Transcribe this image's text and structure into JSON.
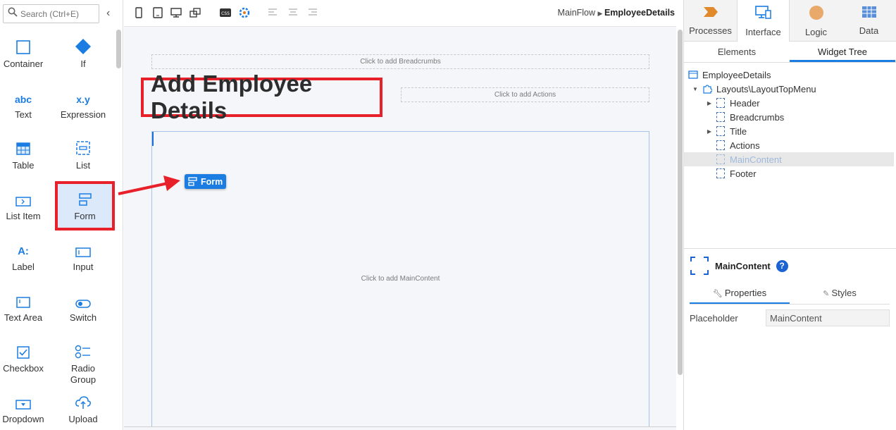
{
  "toolbox": {
    "search_placeholder": "Search (Ctrl+E)",
    "collapse_glyph": "‹",
    "tools": [
      {
        "label": "Container",
        "icon": "container-icon"
      },
      {
        "label": "If",
        "icon": "if-diamond-icon"
      },
      {
        "label": "Text",
        "icon": "text-abc-icon",
        "glyph": "abc"
      },
      {
        "label": "Expression",
        "icon": "expression-icon",
        "glyph": "x.y"
      },
      {
        "label": "Table",
        "icon": "table-icon"
      },
      {
        "label": "List",
        "icon": "list-icon"
      },
      {
        "label": "List Item",
        "icon": "list-item-icon"
      },
      {
        "label": "Form",
        "icon": "form-icon",
        "selected": true
      },
      {
        "label": "Label",
        "icon": "label-icon",
        "glyph": "A:"
      },
      {
        "label": "Input",
        "icon": "input-icon"
      },
      {
        "label": "Text Area",
        "icon": "text-area-icon"
      },
      {
        "label": "Switch",
        "icon": "switch-icon"
      },
      {
        "label": "Checkbox",
        "icon": "checkbox-icon"
      },
      {
        "label": "Radio Group",
        "icon": "radio-group-icon"
      },
      {
        "label": "Dropdown",
        "icon": "dropdown-icon"
      },
      {
        "label": "Upload",
        "icon": "upload-icon"
      }
    ]
  },
  "canvas": {
    "breadcrumb": {
      "flow": "MainFlow",
      "screen": "EmployeeDetails"
    },
    "breadcrumbs_placeholder": "Click to add Breadcrumbs",
    "title": "Add Employee Details",
    "actions_placeholder": "Click to add Actions",
    "main_placeholder": "Click to add MainContent",
    "drag_chip_label": "Form"
  },
  "right_panel": {
    "tabs": [
      {
        "label": "Processes",
        "icon": "processes-icon"
      },
      {
        "label": "Interface",
        "icon": "interface-icon",
        "active": true
      },
      {
        "label": "Logic",
        "icon": "logic-icon"
      },
      {
        "label": "Data",
        "icon": "data-icon"
      }
    ],
    "subtabs": [
      {
        "label": "Elements"
      },
      {
        "label": "Widget Tree",
        "active": true
      }
    ],
    "tree": [
      {
        "label": "EmployeeDetails",
        "icon": "screen-icon"
      },
      {
        "label": "Layouts\\LayoutTopMenu",
        "icon": "block-icon"
      },
      {
        "label": "Header",
        "icon": "placeholder-icon"
      },
      {
        "label": "Breadcrumbs",
        "icon": "placeholder-icon"
      },
      {
        "label": "Title",
        "icon": "placeholder-icon"
      },
      {
        "label": "Actions",
        "icon": "placeholder-icon"
      },
      {
        "label": "MainContent",
        "icon": "placeholder-icon",
        "selected": true
      },
      {
        "label": "Footer",
        "icon": "placeholder-icon"
      }
    ],
    "properties": {
      "title": "MainContent",
      "help": "?",
      "tabs": [
        {
          "label": "Properties",
          "active": true
        },
        {
          "label": "Styles"
        }
      ],
      "rows": [
        {
          "name": "Placeholder",
          "value": "MainContent"
        }
      ]
    }
  },
  "colors": {
    "accent": "#1b7de1",
    "highlight_red": "#e8202a",
    "selection_bg": "#dbe9fb"
  }
}
